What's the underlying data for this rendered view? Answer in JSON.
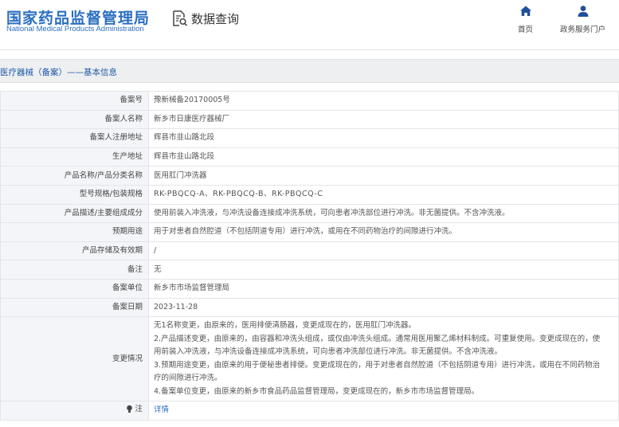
{
  "header": {
    "logo_cn": "国家药品监督管理局",
    "logo_en": "National Medical Products Administration",
    "search_title": "数据查询",
    "nav_home": "首页",
    "nav_portal": "政务服务门户"
  },
  "breadcrumb": "医疗器械（备案）——基本信息",
  "rows": [
    {
      "label": "备案号",
      "value": "豫新械备20170005号"
    },
    {
      "label": "备案人名称",
      "value": "新乡市日康医疗器械厂"
    },
    {
      "label": "备案人注册地址",
      "value": "辉县市韭山路北段"
    },
    {
      "label": "生产地址",
      "value": "辉县市韭山路北段"
    },
    {
      "label": "产品名称/产品分类名称",
      "value": "医用肛门冲洗器"
    },
    {
      "label": "型号规格/包装规格",
      "value": "RK-PBQCQ-A、RK-PBQCQ-B、RK-PBQCQ-C"
    },
    {
      "label": "产品描述/主要组成成分",
      "value": "使用前装入冲洗液，与冲洗设备连接成冲洗系统，可向患者冲洗部位进行冲洗。非无菌提供。不含冲洗液。"
    },
    {
      "label": "预期用途",
      "value": "用于对患者自然腔道（不包括阴道专用）进行冲洗，或用在不同药物治疗的间隙进行冲洗。"
    },
    {
      "label": "产品存储及有效期",
      "value": "/"
    },
    {
      "label": "备注",
      "value": "无"
    },
    {
      "label": "备案单位",
      "value": "新乡市市场监督管理局"
    },
    {
      "label": "备案日期",
      "value": "2023-11-28"
    }
  ],
  "changes": {
    "label": "变更情况",
    "lines": [
      "无1名称变更，由原来的，医用排便清肠器，变更成现在的，医用肛门冲洗器。",
      "2.产品描述变更，由原来的，由容器和冲洗头组成，或仅由冲洗头组成。通常用医用聚乙烯材料制成。可重复使用。变更成现在的，使",
      "用前装入冲洗液，与冲洗设备连接成冲洗系统，可向患者冲洗部位进行冲洗。非无菌提供。不含冲洗液。",
      "3.预期用途变更，由原来的用于便秘患者排便。变更成现在的，用于对患者自然腔道（不包括阴道专用）进行冲洗，或用在不同药物治",
      "疗的间隙进行冲洗。",
      "4.备案单位变更，由原来的新乡市食品药品监督管理局，变更成现在的，新乡市市场监督管理局。"
    ]
  },
  "note": {
    "label": "注",
    "link": "详情"
  },
  "colors": {
    "brand_blue": "#2c6fc0",
    "link_blue": "#2f6fbf",
    "label_bg": "#f3f5f8",
    "subhead_bg": "#eeeff1"
  },
  "icons": {
    "search_doc": "document-search-icon",
    "home": "home-icon",
    "user": "user-icon",
    "note": "lightbulb-icon"
  }
}
